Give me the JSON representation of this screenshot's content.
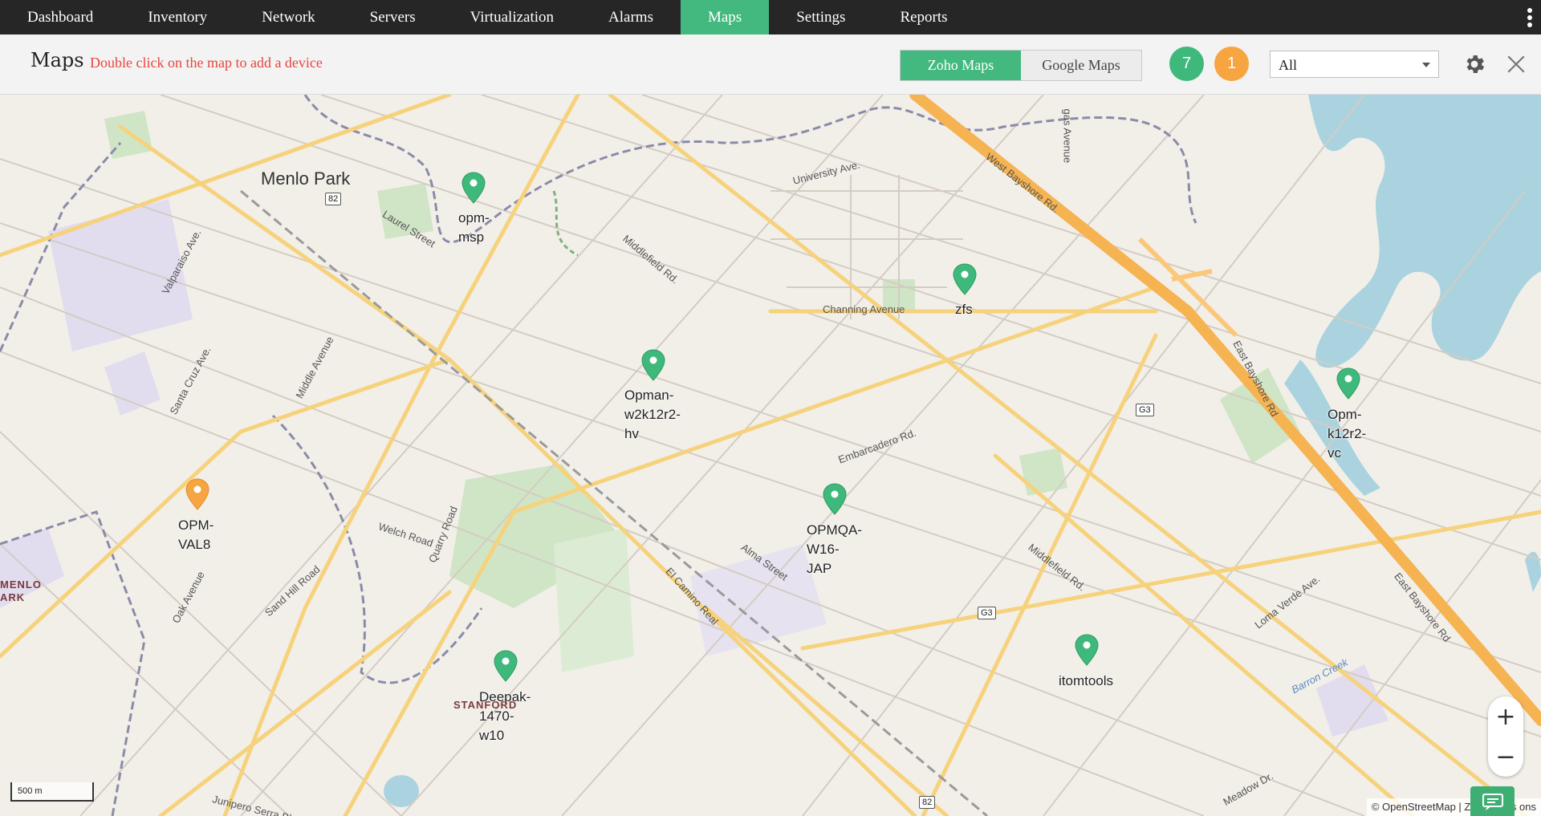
{
  "nav": {
    "items": [
      "Dashboard",
      "Inventory",
      "Network",
      "Servers",
      "Virtualization",
      "Alarms",
      "Maps",
      "Settings",
      "Reports"
    ],
    "active": "Maps"
  },
  "header": {
    "title": "Maps",
    "hint": "Double click on the map to add a device",
    "map_sources": [
      "Zoho Maps",
      "Google Maps"
    ],
    "active_source": "Zoho Maps",
    "count_up": "7",
    "count_down": "1",
    "filter_value": "All"
  },
  "map": {
    "places": [
      {
        "name": "Menlo Park"
      },
      {
        "name": "MENLO"
      },
      {
        "name": "ARK"
      },
      {
        "name": "STANFORD"
      }
    ],
    "streets": [
      "University Ave.",
      "West Bayshore Rd.",
      "Laurel Street",
      "Middlefield Rd.",
      "Channing Avenue",
      "Valparaiso Ave.",
      "Middle Avenue",
      "Santa Cruz Ave.",
      "Embarcadero Rd.",
      "East Bayshore Rd",
      "Welch Road",
      "Quarry Road",
      "Sand Hill Road",
      "Oak Avenue",
      "Alma Street",
      "El Camino Real",
      "Middlefield Rd.",
      "Loma Verde Ave.",
      "East Bayshore Rd",
      "Barron Creek",
      "Junipero Serra Blvd",
      "Meadow Dr.",
      "gas Avenue"
    ],
    "shields": [
      "82",
      "G3",
      "G3",
      "82"
    ],
    "devices": [
      {
        "name": "opm-\nmsp",
        "status": "up"
      },
      {
        "name": "zfs",
        "status": "up"
      },
      {
        "name": "Opman-\nw2k12r2-\nhv",
        "status": "up"
      },
      {
        "name": "Opm-\nk12r2-\nvc",
        "status": "up"
      },
      {
        "name": "OPM-\nVAL8",
        "status": "down"
      },
      {
        "name": "OPMQA-\nW16-\nJAP",
        "status": "up"
      },
      {
        "name": "itomtools",
        "status": "up"
      },
      {
        "name": "Deepak-\n1470-\nw10",
        "status": "up"
      }
    ],
    "colors": {
      "up": "#3fb97b",
      "down": "#f7a541"
    },
    "scale": "500 m",
    "attribution": "© OpenStreetMap |  Zoho Maps  ons"
  }
}
